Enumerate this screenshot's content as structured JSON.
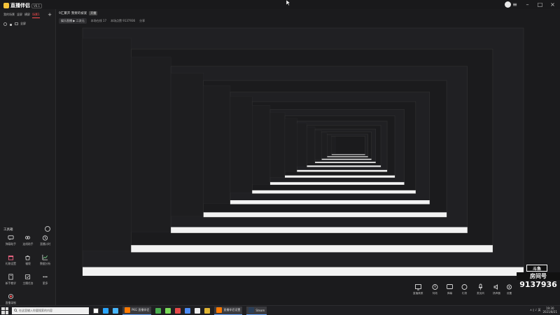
{
  "app": {
    "logo_text": "直播伴侣",
    "version": "V6.1",
    "window_controls": [
      "menu-icon",
      "minimize-icon",
      "maximize-icon",
      "close-icon"
    ]
  },
  "sidebar": {
    "tabs": [
      "我的场景",
      "竖屏",
      "横屏",
      "场景1"
    ],
    "active_tab": "场景1",
    "add_label": "+",
    "scene_item": "全屏",
    "tools_title": "工具箱",
    "tools": [
      {
        "label": "弹幕助手",
        "icon": "chat-icon"
      },
      {
        "label": "连线助手",
        "icon": "link-icon"
      },
      {
        "label": "直播计时",
        "icon": "timer-icon"
      },
      {
        "label": "礼物设置",
        "icon": "gift-icon"
      },
      {
        "label": "福袋",
        "icon": "bag-icon"
      },
      {
        "label": "数据分析",
        "icon": "chart-icon"
      },
      {
        "label": "新手教学",
        "icon": "book-icon"
      },
      {
        "label": "主播任务",
        "icon": "task-icon"
      },
      {
        "label": "更多",
        "icon": "more-icon"
      },
      {
        "label": "直播录制",
        "icon": "record-icon"
      }
    ]
  },
  "header": {
    "title": "9汇聚开 我要的被爱",
    "tag": "开播",
    "category": "娱乐直播 ▶ 二次元",
    "viewers": "本场在线 17",
    "likes": "本场点赞 9137936",
    "share": "分享"
  },
  "controls": [
    {
      "label": "直播美颜",
      "icon": "beauty-icon"
    },
    {
      "label": "特效",
      "icon": "effects-icon"
    },
    {
      "label": "弹幕",
      "icon": "danmaku-icon"
    },
    {
      "label": "礼物",
      "icon": "gift-icon"
    },
    {
      "label": "麦克风",
      "icon": "mic-icon"
    },
    {
      "label": "扬声器",
      "icon": "speaker-icon"
    },
    {
      "label": "设置",
      "icon": "settings-icon"
    }
  ],
  "overlay": {
    "logo_text": "斗鱼",
    "room_label": "房间号",
    "room_number": "9137936"
  },
  "taskbar": {
    "search_placeholder": "在这里输入你要搜索的内容",
    "apps": [
      {
        "label": "PKG 直播伴侣"
      },
      {
        "label": "直播伴侣设置"
      },
      {
        "label": "Steam"
      }
    ],
    "time": "19:30",
    "date": "2021/8/21"
  },
  "colors": {
    "accent": "#ff4d4f",
    "brand": "#f5c33a",
    "background": "#1b1b1d"
  }
}
